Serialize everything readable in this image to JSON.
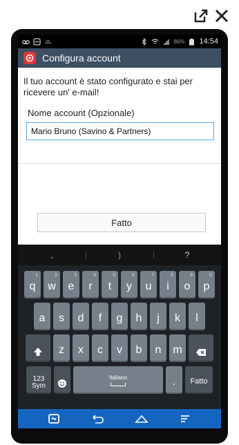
{
  "statusbar": {
    "battery": "86%",
    "time": "14:54"
  },
  "actionbar": {
    "title": "Configura account"
  },
  "content": {
    "message": "Il tuo account è stato configurato e stai per ricevere un' e-mail!",
    "name_label": "Nome account (Opzionale)",
    "name_value": "Mario Bruno (Savino & Partners)",
    "done_label": "Fatto"
  },
  "suggestions": [
    ",",
    ")",
    "?"
  ],
  "keyboard": {
    "row1": [
      {
        "k": "q",
        "s": "1"
      },
      {
        "k": "w",
        "s": "2"
      },
      {
        "k": "e",
        "s": "3"
      },
      {
        "k": "r",
        "s": "4"
      },
      {
        "k": "t",
        "s": "5"
      },
      {
        "k": "y",
        "s": "6"
      },
      {
        "k": "u",
        "s": "7"
      },
      {
        "k": "i",
        "s": "8"
      },
      {
        "k": "o",
        "s": "9"
      },
      {
        "k": "p",
        "s": "0"
      }
    ],
    "row2": [
      "a",
      "s",
      "d",
      "f",
      "g",
      "h",
      "j",
      "k",
      "l"
    ],
    "row3": [
      "z",
      "x",
      "c",
      "v",
      "b",
      "n",
      "m"
    ],
    "sym_label": "123 Sym",
    "language": "Italiano",
    "enter_label": "Fatto"
  },
  "icons": {
    "accent": "#1565c0",
    "input_border": "#5aa9e0"
  }
}
